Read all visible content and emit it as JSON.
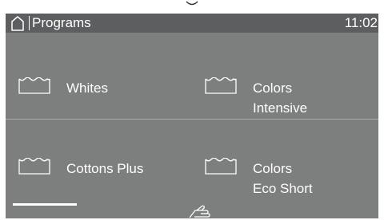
{
  "titlebar": {
    "home_icon": "home-icon",
    "title": "Programs",
    "clock": "11:02"
  },
  "programs": [
    {
      "icon": "tub-icon",
      "label_line1": "Whites",
      "label_line2": ""
    },
    {
      "icon": "tub-icon",
      "label_line1": "Colors",
      "label_line2": "Intensive"
    },
    {
      "icon": "tub-icon",
      "label_line1": "Cottons Plus",
      "label_line2": ""
    },
    {
      "icon": "tub-icon",
      "label_line1": "Colors",
      "label_line2": "Eco Short"
    }
  ],
  "page_indicator": {
    "current_page": 1
  },
  "footer": {
    "icon": "swipe-hand-icon"
  },
  "colors": {
    "screen": "#7d7e7e",
    "titlebar": "#5d5e5f",
    "text": "#ffffff",
    "divider": "#a9aaaa"
  }
}
